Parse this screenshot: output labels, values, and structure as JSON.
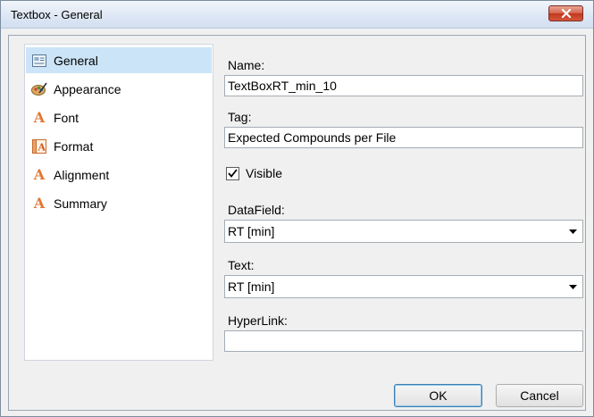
{
  "window": {
    "title": "Textbox - General"
  },
  "nav": {
    "items": [
      {
        "label": "General",
        "icon": "general-icon",
        "selected": true
      },
      {
        "label": "Appearance",
        "icon": "palette-icon",
        "selected": false
      },
      {
        "label": "Font",
        "icon": "font-a-icon",
        "selected": false
      },
      {
        "label": "Format",
        "icon": "format-icon",
        "selected": false
      },
      {
        "label": "Alignment",
        "icon": "alignment-a-icon",
        "selected": false
      },
      {
        "label": "Summary",
        "icon": "summary-a-icon",
        "selected": false
      }
    ]
  },
  "form": {
    "name_label": "Name:",
    "name_value": "TextBoxRT_min_10",
    "tag_label": "Tag:",
    "tag_value": "Expected Compounds per File",
    "visible_label": "Visible",
    "visible_checked": true,
    "datafield_label": "DataField:",
    "datafield_value": "RT [min]",
    "text_label": "Text:",
    "text_value": "RT [min]",
    "hyperlink_label": "HyperLink:",
    "hyperlink_value": ""
  },
  "buttons": {
    "ok_label": "OK",
    "cancel_label": "Cancel"
  },
  "colors": {
    "selection": "#cce4f7",
    "icon_orange": "#e27834",
    "close_red": "#c2371d"
  }
}
